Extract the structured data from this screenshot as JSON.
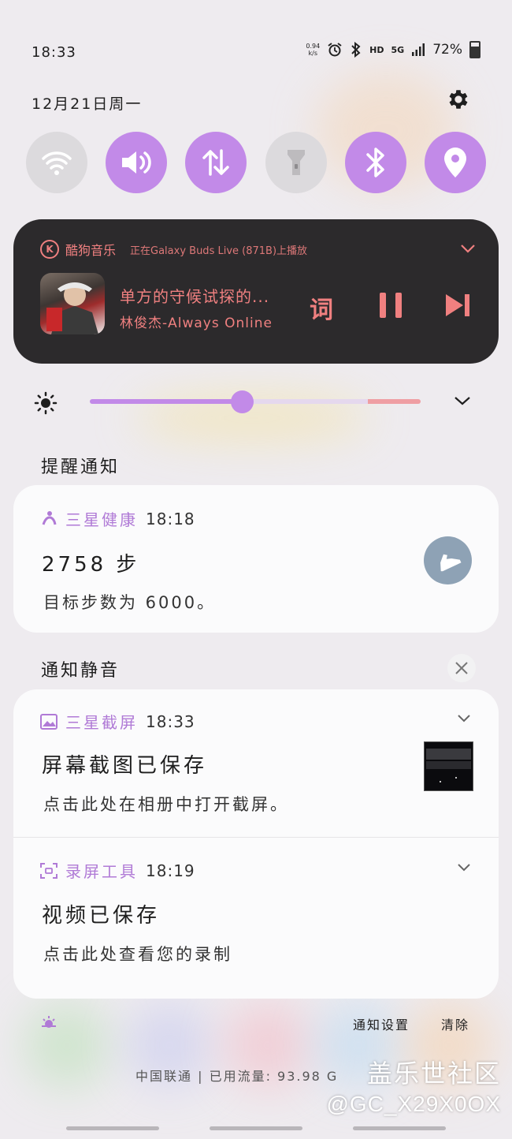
{
  "status_bar": {
    "time": "18:33",
    "net_speed_value": "0.94",
    "net_speed_unit": "k/s",
    "hd": "HD",
    "network": "5G",
    "battery": "72%"
  },
  "header": {
    "date": "12月21日周一"
  },
  "quick_settings": [
    {
      "name": "wifi",
      "state": "off"
    },
    {
      "name": "sound",
      "state": "on"
    },
    {
      "name": "mobile-data",
      "state": "on"
    },
    {
      "name": "flashlight",
      "state": "off"
    },
    {
      "name": "bluetooth",
      "state": "on"
    },
    {
      "name": "location",
      "state": "on"
    }
  ],
  "media": {
    "app_logo": "K",
    "app": "酷狗音乐",
    "output": "正在Galaxy Buds Live (871B)上播放",
    "song": "单方的守候试探的...",
    "artist": "林俊杰-Always Online",
    "lyrics_label": "词",
    "accent": "#f08080"
  },
  "brightness": {
    "level": 0.46
  },
  "alerts": {
    "title": "提醒通知",
    "health": {
      "app": "三星健康",
      "time": "18:18",
      "title": "2758 步",
      "body": "目标步数为 6000。"
    }
  },
  "silent": {
    "title": "通知静音",
    "screenshot": {
      "app": "三星截屏",
      "time": "18:33",
      "title": "屏幕截图已保存",
      "body": "点击此处在相册中打开截屏。"
    },
    "recorder": {
      "app": "录屏工具",
      "time": "18:19",
      "title": "视频已保存",
      "body": "点击此处查看您的录制"
    }
  },
  "footer": {
    "notification_settings": "通知设置",
    "clear": "清除",
    "carrier": "中国联通 | 已用流量: 93.98 G"
  },
  "watermark": {
    "line1": "盖乐世社区",
    "line2": "@GC_X29X0OX"
  },
  "colors": {
    "accent": "#c28ae8",
    "media_bg": "#2c2a2c"
  }
}
